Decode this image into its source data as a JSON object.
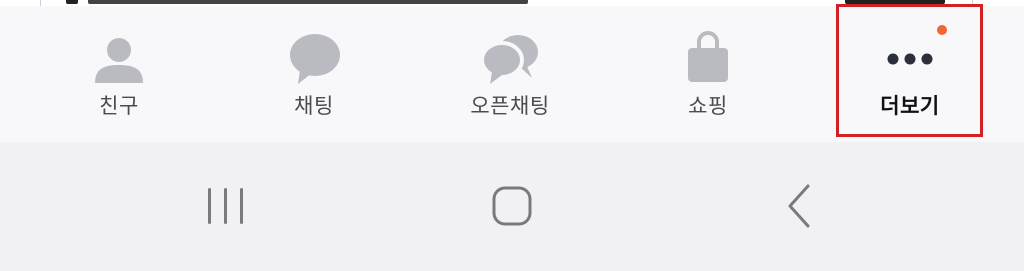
{
  "tabbar": {
    "tabs": [
      {
        "label": "친구",
        "icon": "person-icon"
      },
      {
        "label": "채팅",
        "icon": "chat-bubble-icon"
      },
      {
        "label": "오픈채팅",
        "icon": "open-chat-icon"
      },
      {
        "label": "쇼핑",
        "icon": "shopping-bag-icon"
      },
      {
        "label": "더보기",
        "icon": "more-dots-icon",
        "active": true,
        "badge": "new-dot"
      }
    ]
  },
  "system_nav": {
    "buttons": [
      "recent-apps-icon",
      "home-icon",
      "back-icon"
    ]
  },
  "colors": {
    "icon_gray": "#b9bbc0",
    "active_dark": "#2b2f3a",
    "badge_orange": "#f0653a",
    "highlight_red": "#d41f24",
    "sysnav_icon": "#7a7a7e"
  }
}
